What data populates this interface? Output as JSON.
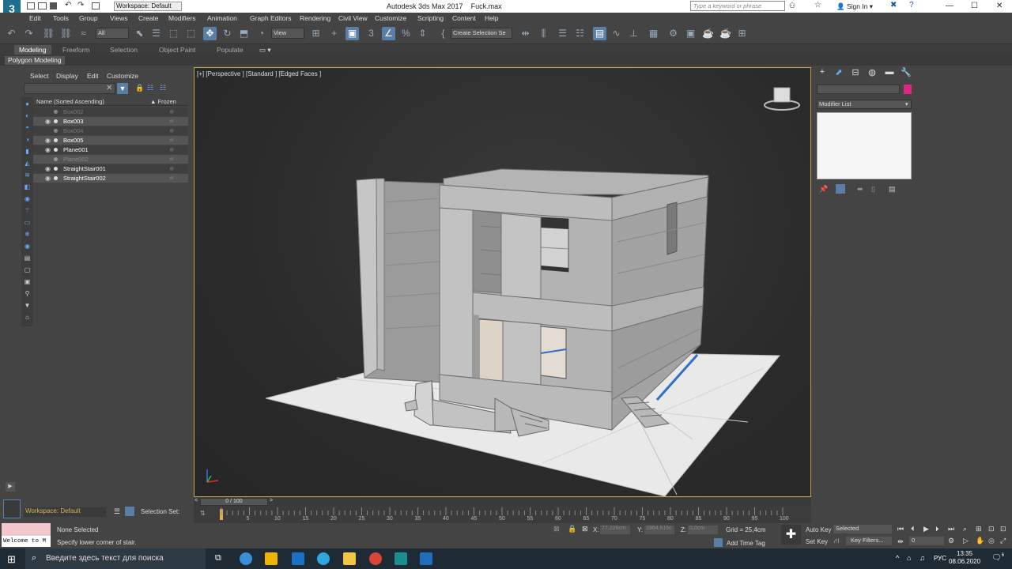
{
  "window": {
    "app_title": "Autodesk 3ds Max 2017",
    "file_name": "Fuck.max",
    "workspace_label": "Workspace: Default",
    "search_placeholder": "Type a keyword or phrase",
    "sign_in": "Sign In"
  },
  "menu": [
    "Edit",
    "Tools",
    "Group",
    "Views",
    "Create",
    "Modifiers",
    "Animation",
    "Graph Editors",
    "Rendering",
    "Civil View",
    "Customize",
    "Scripting",
    "Content",
    "Help"
  ],
  "toolbar": {
    "filter_select": "All",
    "ref_coord_select": "View",
    "selection_set_select": "Create Selection Se"
  },
  "ribbon": {
    "tabs": [
      "Modeling",
      "Freeform",
      "Selection",
      "Object Paint",
      "Populate"
    ],
    "active_tab": "Modeling",
    "sub_label": "Polygon Modeling"
  },
  "scene_explorer": {
    "tabs": [
      "Select",
      "Display",
      "Edit",
      "Customize"
    ],
    "col_name": "Name (Sorted Ascending)",
    "col_frozen": "▲ Frozen",
    "rows": [
      {
        "name": "Box002",
        "visible": false
      },
      {
        "name": "Box003",
        "visible": true
      },
      {
        "name": "Box004",
        "visible": false
      },
      {
        "name": "Box005",
        "visible": true
      },
      {
        "name": "Plane001",
        "visible": true
      },
      {
        "name": "Plane002",
        "visible": false
      },
      {
        "name": "StraightStair001",
        "visible": true
      },
      {
        "name": "StraightStair002",
        "visible": true
      }
    ]
  },
  "viewport": {
    "label": "[+] [Perspective ] [Standard ] [Edged Faces ]"
  },
  "command_panel": {
    "modifier_list": "Modifier List"
  },
  "timeline": {
    "slider": "0 / 100",
    "ticks": [
      "5",
      "10",
      "15",
      "20",
      "25",
      "30",
      "35",
      "40",
      "45",
      "50",
      "55",
      "60",
      "65",
      "70",
      "75",
      "80",
      "85",
      "90",
      "95",
      "100"
    ]
  },
  "status": {
    "workspace": "Workspace: Default",
    "selection_set": "Selection Set:",
    "maxscript": "Welcome to M",
    "selected": "None Selected",
    "prompt": "Specify lower corner of stair.",
    "x_label": "X:",
    "x_value": "77,226cm",
    "y_label": "Y:",
    "y_value": "1984,515c",
    "z_label": "Z:",
    "z_value": "0,0cm",
    "grid": "Grid = 25,4cm",
    "add_time_tag": "Add Time Tag",
    "auto_key": "Auto Key",
    "auto_key_select": "Selected",
    "set_key": "Set Key",
    "key_filters": "Key Filters...",
    "frame": "0"
  },
  "taskbar": {
    "search": "Введите здесь текст для поиска",
    "lang": "РУС",
    "time": "13:35",
    "date": "08.06.2020",
    "notifications": "6"
  },
  "colors": {
    "object_color": "#e2238c",
    "viewport_border": "#c8a24a",
    "active_button": "#5a7fa6"
  }
}
